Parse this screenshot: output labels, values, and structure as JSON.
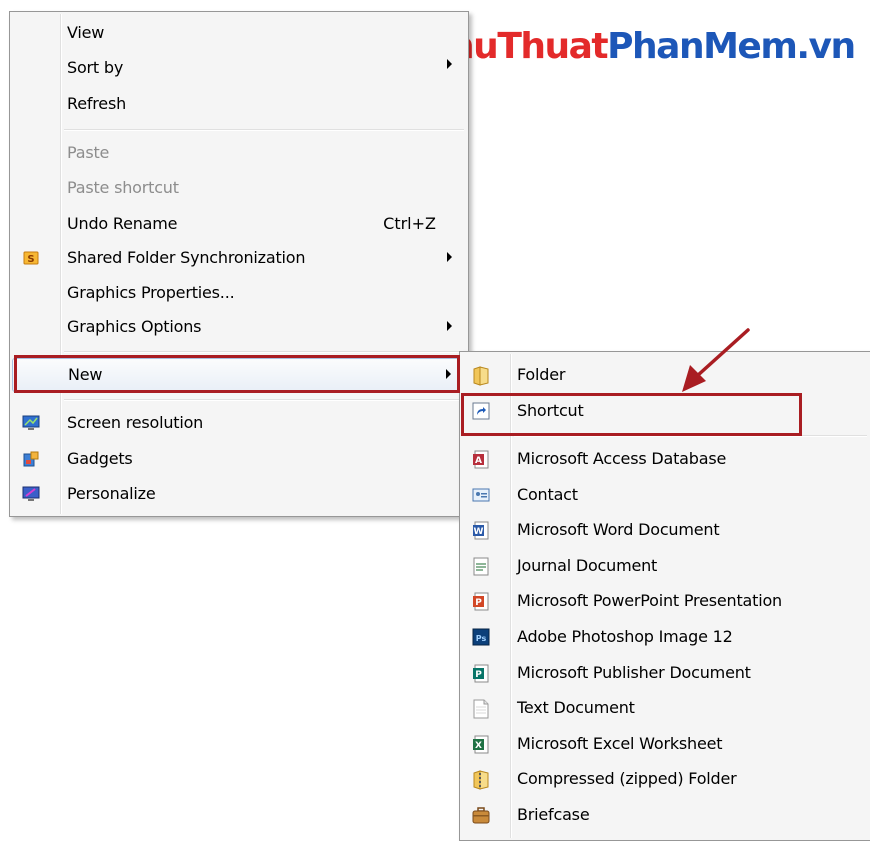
{
  "logo": {
    "part1": "ThuThuat",
    "part2": "PhanMem.vn"
  },
  "context_menu": {
    "view": "View",
    "sort_by": "Sort by",
    "refresh": "Refresh",
    "paste": "Paste",
    "paste_shortcut": "Paste shortcut",
    "undo_rename": "Undo Rename",
    "undo_shortcut": "Ctrl+Z",
    "shared_folder_sync": "Shared Folder Synchronization",
    "graphics_properties": "Graphics Properties...",
    "graphics_options": "Graphics Options",
    "new": "New",
    "screen_resolution": "Screen resolution",
    "gadgets": "Gadgets",
    "personalize": "Personalize"
  },
  "new_submenu": {
    "folder": "Folder",
    "shortcut": "Shortcut",
    "access": "Microsoft Access Database",
    "contact": "Contact",
    "word": "Microsoft Word Document",
    "journal": "Journal Document",
    "powerpoint": "Microsoft PowerPoint Presentation",
    "photoshop": "Adobe Photoshop Image 12",
    "publisher": "Microsoft Publisher Document",
    "text": "Text Document",
    "excel": "Microsoft Excel Worksheet",
    "zip": "Compressed (zipped) Folder",
    "briefcase": "Briefcase"
  },
  "colors": {
    "highlight_box": "#a91d22",
    "logo_red": "#e32a2a",
    "logo_blue": "#1d57b8"
  }
}
